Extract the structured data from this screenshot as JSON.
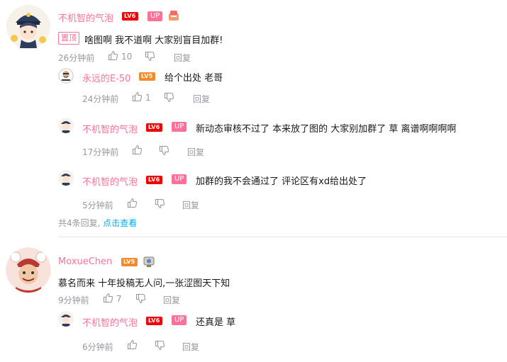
{
  "colors": {
    "pink": "#fb7299",
    "blue": "#00aeec",
    "gray": "#9499a0",
    "lv6": "#ee0505",
    "lv5": "#f28b28"
  },
  "comments": [
    {
      "user": "不机智的气泡",
      "level": "LV6",
      "up_badge": "UP",
      "pin_label": "置顶",
      "text": "啥图啊 我不道啊 大家别盲目加群!",
      "time": "26分钟前",
      "likes": "10",
      "reply_label": "回复",
      "replies": [
        {
          "user": "永远的E-50",
          "level": "LV5",
          "text": "给个出处 老哥",
          "time": "24分钟前",
          "likes": "1",
          "reply_label": "回复"
        },
        {
          "user": "不机智的气泡",
          "level": "LV6",
          "up_badge": "UP",
          "text": "新动态审核不过了 本来放了图的 大家别加群了 草 离谱啊啊啊啊",
          "time": "17分钟前",
          "reply_label": "回复"
        },
        {
          "user": "不机智的气泡",
          "level": "LV6",
          "up_badge": "UP",
          "text": "加群的我不会通过了 评论区有xd给出处了",
          "time": "5分钟前",
          "reply_label": "回复"
        }
      ],
      "reply_count": "共4条回复,",
      "expand_link": "点击查看"
    },
    {
      "user": "MoxueChen",
      "level": "LV5",
      "text": "慕名而来 十年投稿无人问,一张涩图天下知",
      "time": "9分钟前",
      "likes": "7",
      "reply_label": "回复",
      "replies": [
        {
          "user": "不机智的气泡",
          "level": "LV6",
          "up_badge": "UP",
          "text": "还真是 草",
          "time": "6分钟前",
          "reply_label": "回复"
        }
      ]
    }
  ]
}
